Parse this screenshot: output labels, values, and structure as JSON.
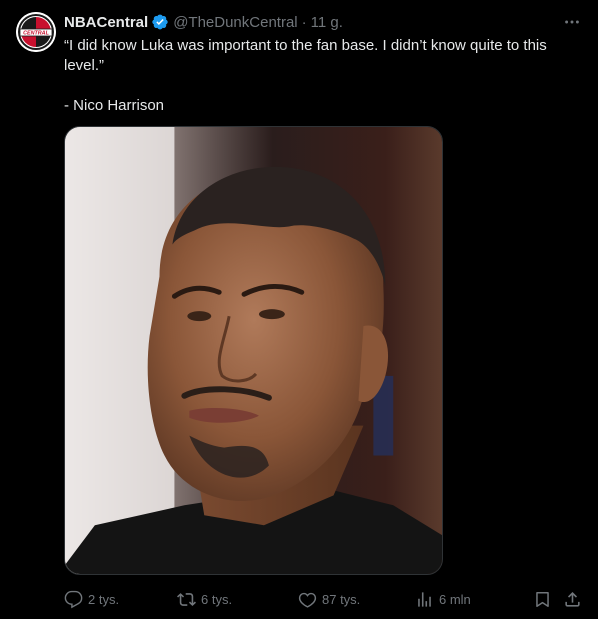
{
  "author": {
    "name": "NBACentral",
    "handle": "@TheDunkCentral",
    "separator": "·",
    "time": "11 g.",
    "avatar_text": "CENTRAL"
  },
  "tweet": {
    "text": "“I did know Luka was important to the fan base. I didn’t know quite to this level.”\n\n- Nico Harrison"
  },
  "actions": {
    "replies": "2 tys.",
    "retweets": "6 tys.",
    "likes": "87 tys.",
    "views": "6 mln"
  },
  "icons": {
    "verified": "verified-badge-icon",
    "more": "more-options-icon",
    "reply": "reply-icon",
    "retweet": "retweet-icon",
    "like": "heart-icon",
    "views": "views-chart-icon",
    "bookmark": "bookmark-icon",
    "share": "share-icon"
  },
  "colors": {
    "background": "#000000",
    "text_primary": "#e7e9ea",
    "text_secondary": "#71767b",
    "verified_blue": "#1d9bf0",
    "brand_red": "#c8102e"
  }
}
